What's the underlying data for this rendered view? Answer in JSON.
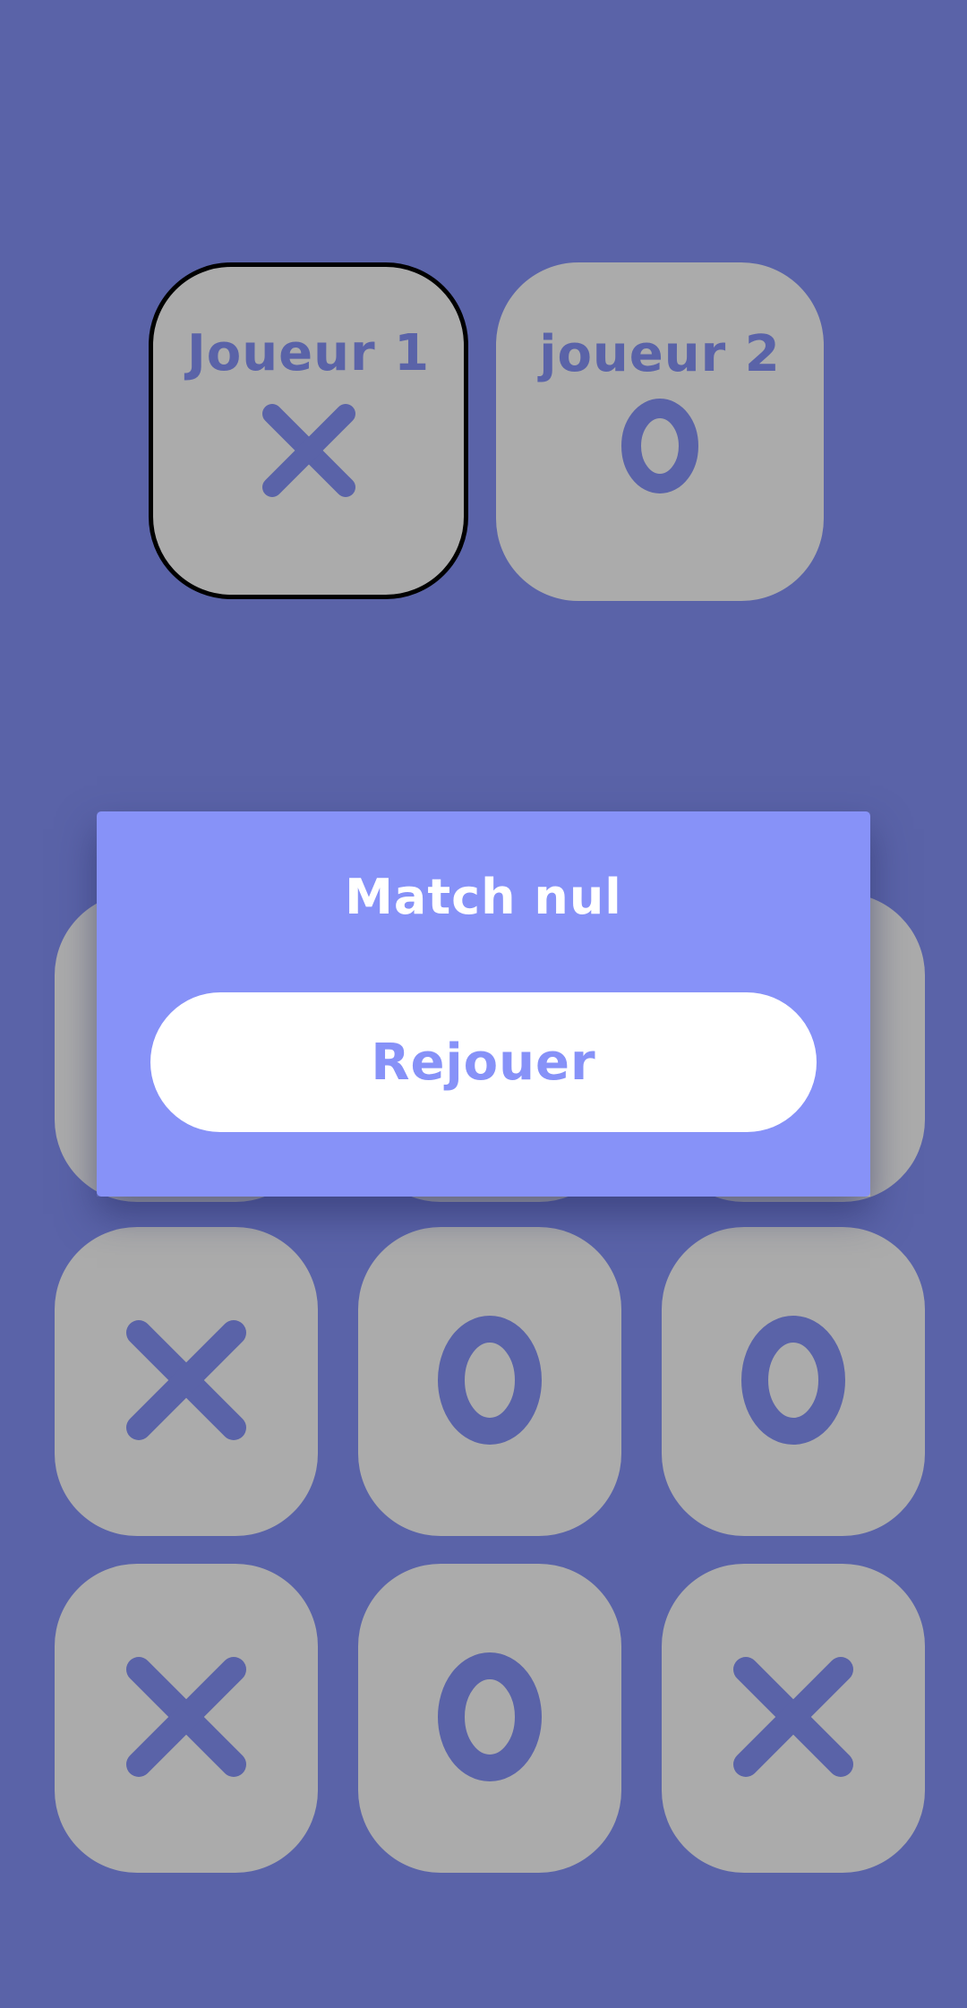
{
  "colors": {
    "background": "#5a63a8",
    "card": "#ababab",
    "symbol": "#5a63a8",
    "dialog": "#8792f8",
    "button": "#ffffff",
    "active_border": "#000000"
  },
  "players": [
    {
      "label": "Joueur 1",
      "symbol": "X",
      "active": true
    },
    {
      "label": "joueur 2",
      "symbol": "O",
      "active": false
    }
  ],
  "board": [
    [
      "",
      "",
      ""
    ],
    [
      "X",
      "O",
      "O"
    ],
    [
      "X",
      "O",
      "X"
    ]
  ],
  "dialog": {
    "title": "Match nul",
    "button_label": "Rejouer"
  }
}
